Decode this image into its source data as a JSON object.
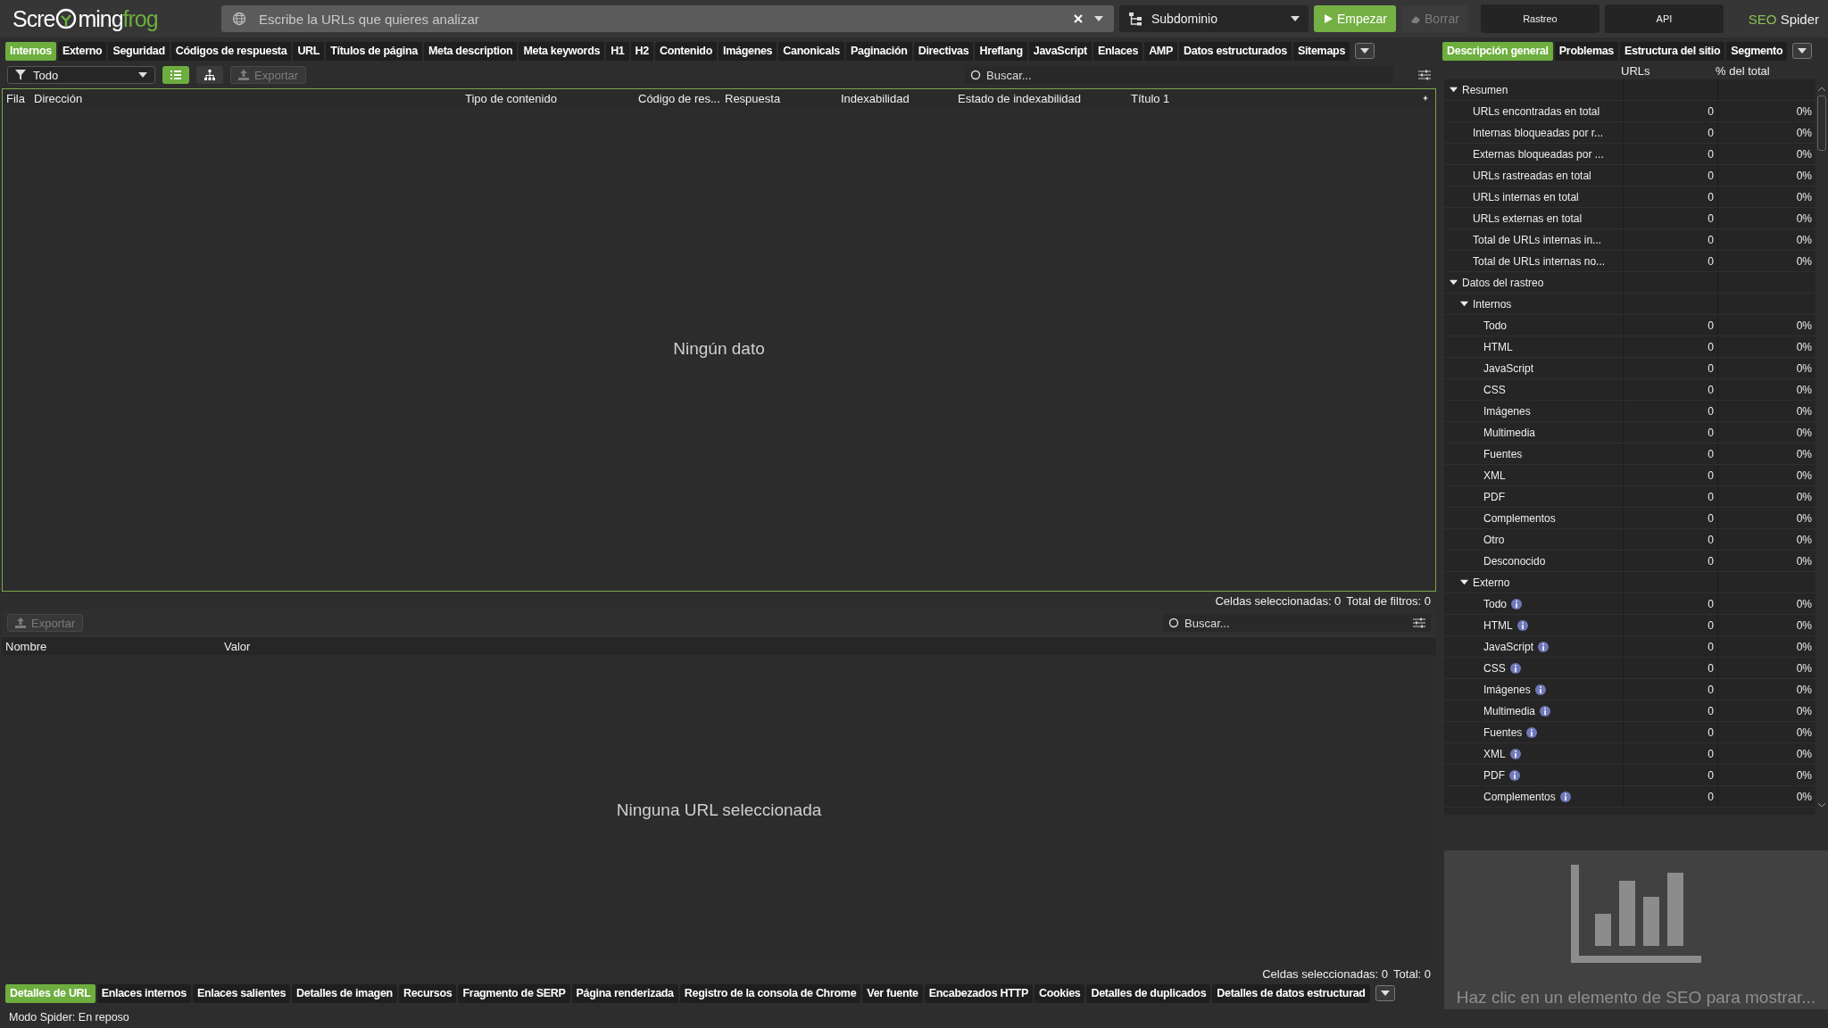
{
  "logo": {
    "before": "Scre",
    "middle": "ming",
    "accent": "frog"
  },
  "url_field": {
    "placeholder": "Escribe la URLs que quieres analizar"
  },
  "mode_dropdown": {
    "value": "Subdominio"
  },
  "start_button": {
    "label": "Empezar",
    "disabled": false
  },
  "clear_button": {
    "label": "Borrar",
    "disabled": true
  },
  "mode_tabs": [
    {
      "label": "Rastreo"
    },
    {
      "label": "API"
    }
  ],
  "product": {
    "brand": "SEO",
    "name": "Spider"
  },
  "main_tabs": [
    {
      "label": "Internos",
      "selected": true
    },
    {
      "label": "Externo",
      "selected": false
    },
    {
      "label": "Seguridad",
      "selected": false
    },
    {
      "label": "Códigos de respuesta",
      "selected": false
    },
    {
      "label": "URL",
      "selected": false
    },
    {
      "label": "Títulos de página",
      "selected": false
    },
    {
      "label": "Meta description",
      "selected": false
    },
    {
      "label": "Meta keywords",
      "selected": false
    },
    {
      "label": "H1",
      "selected": false
    },
    {
      "label": "H2",
      "selected": false
    },
    {
      "label": "Contenido",
      "selected": false
    },
    {
      "label": "Imágenes",
      "selected": false
    },
    {
      "label": "Canonicals",
      "selected": false
    },
    {
      "label": "Paginación",
      "selected": false
    },
    {
      "label": "Directivas",
      "selected": false
    },
    {
      "label": "Hreflang",
      "selected": false
    },
    {
      "label": "JavaScript",
      "selected": false
    },
    {
      "label": "Enlaces",
      "selected": false
    },
    {
      "label": "AMP",
      "selected": false
    },
    {
      "label": "Datos estructurados",
      "selected": false
    },
    {
      "label": "Sitemaps",
      "selected": false
    }
  ],
  "toolbar": {
    "filter": "Todo",
    "views": [
      {
        "kind": "list",
        "selected": true
      },
      {
        "kind": "tree",
        "selected": false
      }
    ],
    "export": {
      "label": "Exportar",
      "disabled": true
    },
    "search": {
      "placeholder": "Buscar..."
    }
  },
  "table": {
    "columns": [
      "Fila",
      "Dirección",
      "Tipo de contenido",
      "Código de res...",
      "Respuesta",
      "Indexabilidad",
      "Estado de indexabilidad",
      "Título 1"
    ],
    "empty": "Ningún dato",
    "status": [
      "Celdas seleccionadas: 0",
      "Total de filtros: 0"
    ]
  },
  "details": {
    "export": {
      "label": "Exportar",
      "disabled": true
    },
    "search": {
      "placeholder": "Buscar..."
    },
    "columns": [
      "Nombre",
      "Valor"
    ],
    "empty": "Ninguna URL seleccionada",
    "status": [
      "Celdas seleccionadas: 0",
      "Total: 0"
    ]
  },
  "bottom_tabs": [
    {
      "label": "Detalles de URL",
      "selected": true
    },
    {
      "label": "Enlaces internos",
      "selected": false
    },
    {
      "label": "Enlaces salientes",
      "selected": false
    },
    {
      "label": "Detalles de imagen",
      "selected": false
    },
    {
      "label": "Recursos",
      "selected": false
    },
    {
      "label": "Fragmento de SERP",
      "selected": false
    },
    {
      "label": "Página renderizada",
      "selected": false
    },
    {
      "label": "Registro de la consola de Chrome",
      "selected": false
    },
    {
      "label": "Ver fuente",
      "selected": false
    },
    {
      "label": "Encabezados HTTP",
      "selected": false
    },
    {
      "label": "Cookies",
      "selected": false
    },
    {
      "label": "Detalles de duplicados",
      "selected": false
    },
    {
      "label": "Detalles de datos estructurad",
      "selected": false
    }
  ],
  "status_bar": "Modo Spider: En reposo",
  "overview": {
    "tabs": [
      {
        "label": "Descripción general",
        "selected": true
      },
      {
        "label": "Problemas",
        "selected": false
      },
      {
        "label": "Estructura del sitio",
        "selected": false
      },
      {
        "label": "Segmento",
        "selected": false
      }
    ],
    "columns": [
      "URLs",
      "% del total"
    ],
    "tree": [
      {
        "label": "Resumen",
        "expanded": true,
        "children": [
          {
            "label": "URLs encontradas en total",
            "urls": "0",
            "percent": "0%"
          },
          {
            "label": "Internas bloqueadas por r...",
            "urls": "0",
            "percent": "0%"
          },
          {
            "label": "Externas bloqueadas por ...",
            "urls": "0",
            "percent": "0%"
          },
          {
            "label": "URLs rastreadas en total",
            "urls": "0",
            "percent": "0%"
          },
          {
            "label": "URLs internas en total",
            "urls": "0",
            "percent": "0%"
          },
          {
            "label": "URLs externas en total",
            "urls": "0",
            "percent": "0%"
          },
          {
            "label": "Total de URLs internas in...",
            "urls": "0",
            "percent": "0%"
          },
          {
            "label": "Total de URLs internas no...",
            "urls": "0",
            "percent": "0%"
          }
        ]
      },
      {
        "label": "Datos del rastreo",
        "expanded": true,
        "children": [
          {
            "label": "Internos",
            "expanded": true,
            "children": [
              {
                "label": "Todo",
                "urls": "0",
                "percent": "0%"
              },
              {
                "label": "HTML",
                "urls": "0",
                "percent": "0%"
              },
              {
                "label": "JavaScript",
                "urls": "0",
                "percent": "0%"
              },
              {
                "label": "CSS",
                "urls": "0",
                "percent": "0%"
              },
              {
                "label": "Imágenes",
                "urls": "0",
                "percent": "0%"
              },
              {
                "label": "Multimedia",
                "urls": "0",
                "percent": "0%"
              },
              {
                "label": "Fuentes",
                "urls": "0",
                "percent": "0%"
              },
              {
                "label": "XML",
                "urls": "0",
                "percent": "0%"
              },
              {
                "label": "PDF",
                "urls": "0",
                "percent": "0%"
              },
              {
                "label": "Complementos",
                "urls": "0",
                "percent": "0%"
              },
              {
                "label": "Otro",
                "urls": "0",
                "percent": "0%"
              },
              {
                "label": "Desconocido",
                "urls": "0",
                "percent": "0%"
              }
            ]
          },
          {
            "label": "Externo",
            "expanded": true,
            "children": [
              {
                "label": "Todo",
                "urls": "0",
                "percent": "0%",
                "info": true
              },
              {
                "label": "HTML",
                "urls": "0",
                "percent": "0%",
                "info": true
              },
              {
                "label": "JavaScript",
                "urls": "0",
                "percent": "0%",
                "info": true
              },
              {
                "label": "CSS",
                "urls": "0",
                "percent": "0%",
                "info": true
              },
              {
                "label": "Imágenes",
                "urls": "0",
                "percent": "0%",
                "info": true
              },
              {
                "label": "Multimedia",
                "urls": "0",
                "percent": "0%",
                "info": true
              },
              {
                "label": "Fuentes",
                "urls": "0",
                "percent": "0%",
                "info": true
              },
              {
                "label": "XML",
                "urls": "0",
                "percent": "0%",
                "info": true
              },
              {
                "label": "PDF",
                "urls": "0",
                "percent": "0%",
                "info": true
              },
              {
                "label": "Complementos",
                "urls": "0",
                "percent": "0%",
                "info": true
              }
            ]
          }
        ]
      }
    ],
    "chart_hint": "Haz clic en un elemento de SEO para mostrar..."
  }
}
